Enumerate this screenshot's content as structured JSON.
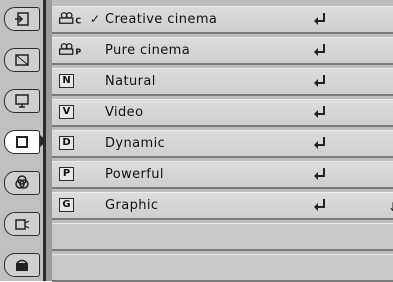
{
  "tabs": [
    {
      "name": "input"
    },
    {
      "name": "screen"
    },
    {
      "name": "pc-adjust"
    },
    {
      "name": "image-select",
      "active": true
    },
    {
      "name": "color"
    },
    {
      "name": "sound"
    },
    {
      "name": "setting"
    }
  ],
  "menu": {
    "items": [
      {
        "icon": "film-c-icon",
        "icon_text": "C",
        "label": "Creative cinema",
        "selected": true,
        "check": "✓"
      },
      {
        "icon": "film-p-icon",
        "icon_text": "P",
        "label": "Pure cinema"
      },
      {
        "icon": "n-box-icon",
        "icon_text": "N",
        "label": "Natural"
      },
      {
        "icon": "v-box-icon",
        "icon_text": "V",
        "label": "Video"
      },
      {
        "icon": "d-box-icon",
        "icon_text": "D",
        "label": "Dynamic"
      },
      {
        "icon": "p-box-icon",
        "icon_text": "P",
        "label": "Powerful"
      },
      {
        "icon": "g-box-icon",
        "icon_text": "G",
        "label": "Graphic"
      }
    ],
    "enter_icon": "enter-icon",
    "down_indicator": "↓"
  }
}
